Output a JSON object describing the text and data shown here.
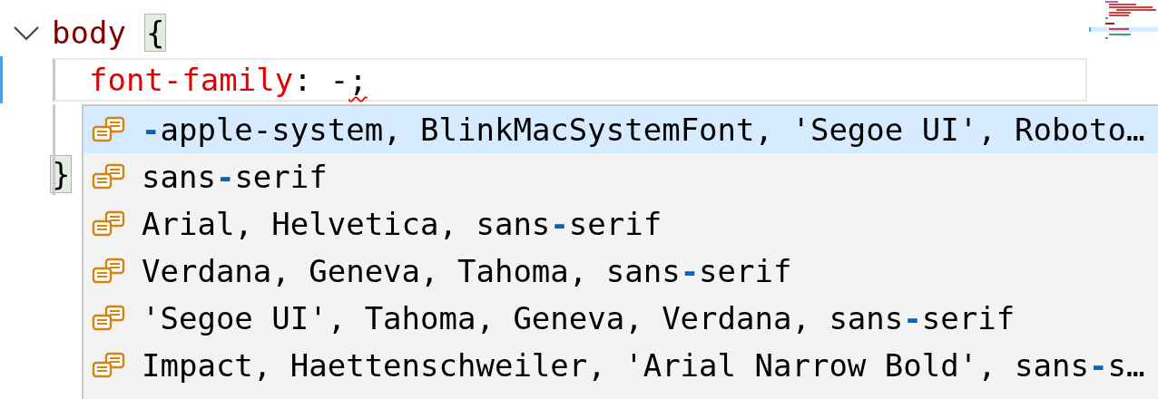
{
  "editor": {
    "lines": [
      {
        "kind": "rule",
        "expanded": true,
        "selector": "body",
        "brace": "{",
        "brace_matched": true
      },
      {
        "kind": "declaration",
        "current": true,
        "property": "font-family",
        "colon": ":",
        "value": "-",
        "terminator": ";",
        "error": true
      },
      {
        "kind": "blank"
      },
      {
        "kind": "close",
        "brace": "}",
        "brace_matched": true
      }
    ]
  },
  "suggestions": [
    {
      "selected": true,
      "match": "-",
      "after": "apple-system, BlinkMacSystemFont, 'Segoe UI', Roboto…"
    },
    {
      "selected": false,
      "before": "sans",
      "match": "-",
      "after": "serif"
    },
    {
      "selected": false,
      "before": "Arial, Helvetica, sans",
      "match": "-",
      "after": "serif"
    },
    {
      "selected": false,
      "before": "Verdana, Geneva, Tahoma, sans",
      "match": "-",
      "after": "serif"
    },
    {
      "selected": false,
      "before": "'Segoe UI', Tahoma, Geneva, Verdana, sans",
      "match": "-",
      "after": "serif"
    },
    {
      "selected": false,
      "before": "Impact, Haettenschweiler, 'Arial Narrow Bold', sans",
      "match": "-",
      "after": "s…"
    }
  ]
}
